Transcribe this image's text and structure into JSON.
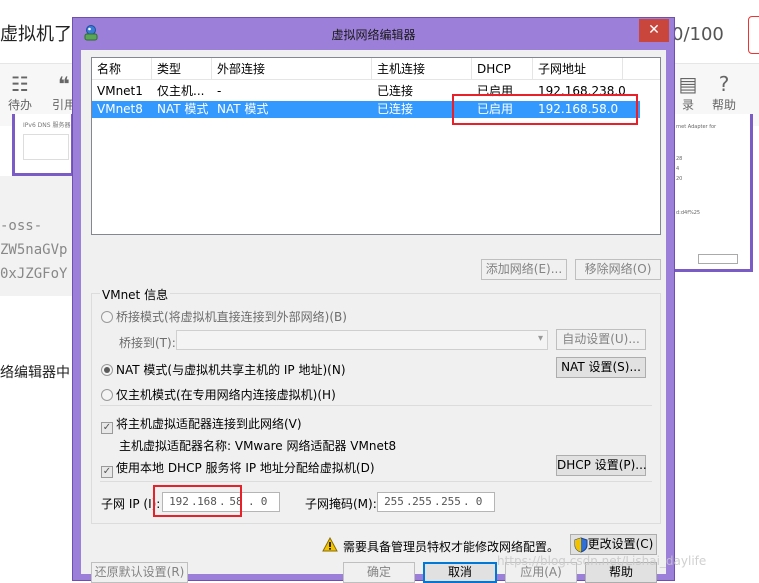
{
  "background": {
    "page_title_fragment": "虚拟机了",
    "word_count": "0/100",
    "toolbar_left": [
      {
        "label": "待办",
        "icon": "todo-icon"
      },
      {
        "label": "引用",
        "icon": "quote-icon"
      }
    ],
    "toolbar_right": [
      {
        "label": "录",
        "icon": "directory-icon"
      },
      {
        "label": "帮助",
        "icon": "help-icon"
      }
    ],
    "thumb_left_text": "IPv6 DNS 服务器",
    "thumb_right_lines": [
      "rnet Adapter for",
      "28",
      "4",
      "20",
      "d:d4f%25"
    ],
    "code_lines": [
      "-oss-",
      "ZW5naGVp",
      "0xJZGFoY"
    ],
    "paragraph_fragment": "络编辑器中"
  },
  "dialog": {
    "title": "虚拟网络编辑器",
    "close_symbol": "✕",
    "list": {
      "headers": [
        "名称",
        "类型",
        "外部连接",
        "主机连接",
        "DHCP",
        "子网地址"
      ],
      "rows": [
        {
          "name": "VMnet1",
          "type": "仅主机...",
          "external": "-",
          "host": "已连接",
          "dhcp": "已启用",
          "subnet": "192.168.238.0",
          "selected": false
        },
        {
          "name": "VMnet8",
          "type": "NAT 模式",
          "external": "NAT 模式",
          "host": "已连接",
          "dhcp": "已启用",
          "subnet": "192.168.58.0",
          "selected": true
        }
      ]
    },
    "add_network_button": "添加网络(E)...",
    "remove_network_button": "移除网络(O)",
    "vmnet_info": {
      "group_label": "VMnet 信息",
      "bridged_option": "桥接模式(将虚拟机直接连接到外部网络)(B)",
      "bridged_to_label": "桥接到(T):",
      "auto_settings_button": "自动设置(U)...",
      "nat_option": "NAT 模式(与虚拟机共享主机的 IP 地址)(N)",
      "nat_settings_button": "NAT 设置(S)...",
      "hostonly_option": "仅主机模式(在专用网络内连接虚拟机)(H)",
      "connect_adapter_option": "将主机虚拟适配器连接到此网络(V)",
      "adapter_name_text": "主机虚拟适配器名称: VMware 网络适配器 VMnet8",
      "dhcp_option": "使用本地 DHCP 服务将 IP 地址分配给虚拟机(D)",
      "dhcp_settings_button": "DHCP 设置(P)...",
      "subnet_ip_label": "子网 IP (I):",
      "subnet_ip": [
        "192",
        "168",
        "58",
        "0"
      ],
      "subnet_mask_label": "子网掩码(M):",
      "subnet_mask": [
        "255",
        "255",
        "255",
        "0"
      ]
    },
    "admin_notice": "需要具备管理员特权才能修改网络配置。",
    "change_settings_button": "更改设置(C)",
    "restore_defaults_button": "还原默认设置(R)",
    "ok_button": "确定",
    "cancel_button": "取消",
    "apply_button": "应用(A)",
    "help_button": "帮助"
  },
  "watermark": "https://blog.csdn.net/Lishai_daylife",
  "colors": {
    "window_frame": "#9c7fd8",
    "selection": "#3399ff",
    "highlight_box": "#e8202a",
    "close_button": "#c9463d"
  }
}
